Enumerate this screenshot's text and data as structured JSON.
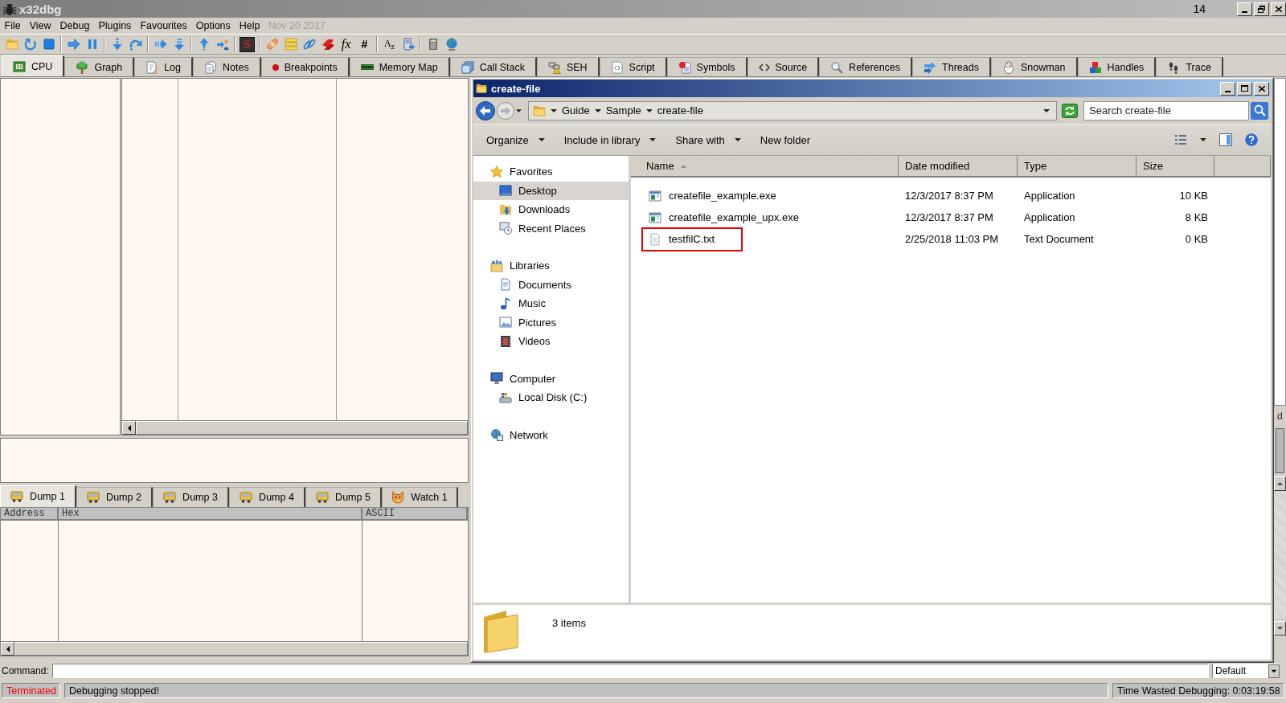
{
  "window": {
    "title": "x32dbg",
    "title_right_text": "14",
    "right_edge_text": "d"
  },
  "menu": [
    "File",
    "View",
    "Debug",
    "Plugins",
    "Favourites",
    "Options",
    "Help"
  ],
  "build_date": "Nov 20 2017",
  "toolbar_glyphs": [
    {
      "kind": "tile",
      "text": "S"
    },
    {
      "kind": "italic",
      "text": "fx"
    },
    {
      "kind": "plain",
      "text": "#"
    },
    {
      "kind": "small",
      "text": "A$_{z}$"
    }
  ],
  "tabs": [
    {
      "label": "CPU",
      "selected": true
    },
    {
      "label": "Graph",
      "selected": false
    },
    {
      "label": "Log",
      "selected": false
    },
    {
      "label": "Notes",
      "selected": false
    },
    {
      "label": "Breakpoints",
      "selected": false
    },
    {
      "label": "Memory Map",
      "selected": false
    },
    {
      "label": "Call Stack",
      "selected": false
    },
    {
      "label": "SEH",
      "selected": false
    },
    {
      "label": "Script",
      "selected": false
    },
    {
      "label": "Symbols",
      "selected": false
    },
    {
      "label": "Source",
      "selected": false
    },
    {
      "label": "References",
      "selected": false
    },
    {
      "label": "Threads",
      "selected": false
    },
    {
      "label": "Snowman",
      "selected": false
    },
    {
      "label": "Handles",
      "selected": false
    },
    {
      "label": "Trace",
      "selected": false
    }
  ],
  "dump_tabs": [
    {
      "label": "Dump 1",
      "selected": true
    },
    {
      "label": "Dump 2",
      "selected": false
    },
    {
      "label": "Dump 3",
      "selected": false
    },
    {
      "label": "Dump 4",
      "selected": false
    },
    {
      "label": "Dump 5",
      "selected": false
    },
    {
      "label": "Watch 1",
      "selected": false
    }
  ],
  "dump_columns": [
    "Address",
    "Hex",
    "ASCII"
  ],
  "command": {
    "label": "Command:",
    "mode": "Default"
  },
  "status_bar": {
    "state": "Terminated",
    "message": "Debugging stopped!",
    "elapsed": "Time Wasted Debugging: 0:03:19:58"
  },
  "explorer": {
    "title": "create-file",
    "breadcrumb": [
      "Guide",
      "Sample",
      "create-file"
    ],
    "search": {
      "placeholder": "Search create-file"
    },
    "commands": [
      {
        "label": "Organize",
        "dropdown": true
      },
      {
        "label": "Include in library",
        "dropdown": true
      },
      {
        "label": "Share with",
        "dropdown": true
      },
      {
        "label": "New folder",
        "dropdown": false
      }
    ],
    "nav": [
      {
        "label": "Favorites",
        "selected": false,
        "children": [
          {
            "label": "Desktop",
            "selected": true
          },
          {
            "label": "Downloads",
            "selected": false
          },
          {
            "label": "Recent Places",
            "selected": false
          }
        ]
      },
      {
        "label": "Libraries",
        "selected": false,
        "children": [
          {
            "label": "Documents",
            "selected": false
          },
          {
            "label": "Music",
            "selected": false
          },
          {
            "label": "Pictures",
            "selected": false
          },
          {
            "label": "Videos",
            "selected": false
          }
        ]
      },
      {
        "label": "Computer",
        "selected": false,
        "children": [
          {
            "label": "Local Disk (C:)",
            "selected": false
          }
        ]
      },
      {
        "label": "Network",
        "selected": false
      }
    ],
    "columns": [
      {
        "label": "Name",
        "sorted": true
      },
      {
        "label": "Date modified",
        "sorted": false
      },
      {
        "label": "Type",
        "sorted": false
      },
      {
        "label": "Size",
        "sorted": false
      }
    ],
    "files": [
      {
        "name": "createfile_example.exe",
        "date_modified": "12/3/2017 8:37 PM",
        "type": "Application",
        "size": "10 KB",
        "kind": "exe",
        "highlighted": false
      },
      {
        "name": "createfile_example_upx.exe",
        "date_modified": "12/3/2017 8:37 PM",
        "type": "Application",
        "size": "8 KB",
        "kind": "exe",
        "highlighted": false
      },
      {
        "name": "testfilC.txt",
        "date_modified": "2/25/2018 11:03 PM",
        "type": "Text Document",
        "size": "0 KB",
        "kind": "txt",
        "highlighted": true
      }
    ],
    "item_count": "3 items"
  }
}
